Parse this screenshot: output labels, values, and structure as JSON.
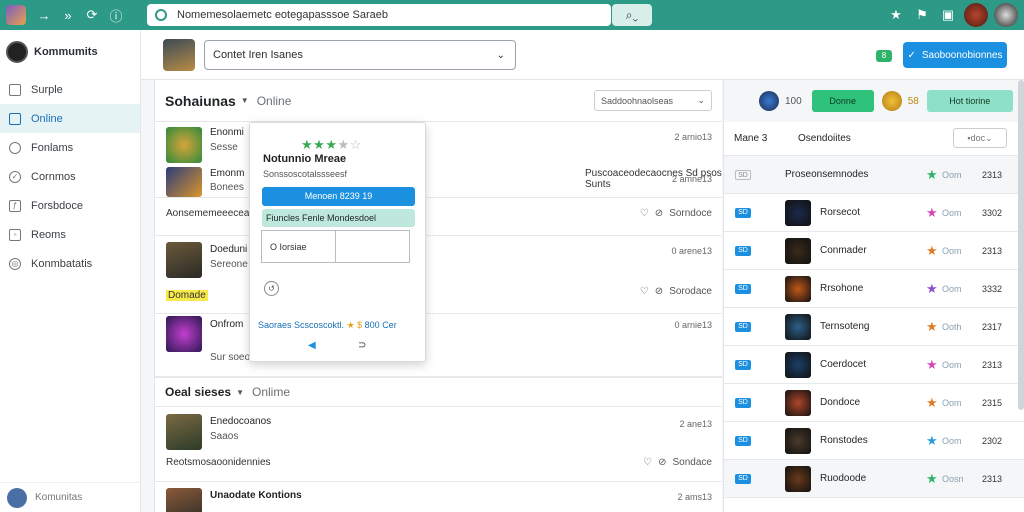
{
  "topbar": {
    "url": "Nomemesolaemetc eotegapasssoe Saraeb",
    "right_icons": [
      "star-icon",
      "flag-icon",
      "grid-icon",
      "avatar",
      "avatar"
    ]
  },
  "sidebar": {
    "brand": "Kommumits",
    "items": [
      {
        "label": "Surple",
        "icon": "square-icon"
      },
      {
        "label": "Online",
        "icon": "square-icon",
        "active": true
      },
      {
        "label": "Fonlams",
        "icon": "circle-icon"
      },
      {
        "label": "Cornmos",
        "icon": "check-icon"
      },
      {
        "label": "Forsbdoce",
        "icon": "tag-icon"
      },
      {
        "label": "Reoms",
        "icon": "chat-icon"
      },
      {
        "label": "Konmbatatis",
        "icon": "globe-icon"
      }
    ],
    "footer": "Komunitas"
  },
  "header": {
    "select_value": "Contet Iren Isanes",
    "badge": "8",
    "primary_button": "Saoboonobionnes"
  },
  "feed": {
    "section1": {
      "title": "Sohaiunas",
      "status": "Online",
      "sort": "Saddoohnaolseas"
    },
    "section2": {
      "title": "Oeal sieses",
      "status": "Onlime"
    },
    "items": [
      {
        "title": "Enonmi",
        "sub": "Sesse",
        "time": "2 arnio13"
      },
      {
        "title": "Emonm",
        "sub": "Bonees",
        "time": "2 amne13",
        "long": "Puscoaceodecaocnes Sd psos Sunts",
        "foot": "Aonsememeeeceass",
        "actions": "Sorndoce"
      },
      {
        "title": "Doeduni",
        "sub": "Sereone",
        "time": "0 arene13",
        "highlight": "Domade",
        "actions": "Sorodace"
      },
      {
        "title": "Onfrom",
        "sub": "Sur soeo",
        "time": "0 arnie13"
      },
      {
        "title": "Enedocoanos",
        "sub": "Saaos",
        "time": "2 ane13",
        "foot": "Reotsmosaoonidennies",
        "actions": "Sondace"
      },
      {
        "title": "Unaodate Kontions",
        "time": "2 ams13"
      }
    ]
  },
  "popover": {
    "rating": 3,
    "title": "Notunnio Mreae",
    "subtitle": "Sonssoscotalssseesf",
    "blue_label": "Menoen 8239 19",
    "green_label": "Fiuncles Fenle Mondesdoel",
    "input_left": "O Iorsiae",
    "link": "Saoraes Scscoscoktl.",
    "link_rating": "800",
    "link_tail": "Cer",
    "prev_label": "◀",
    "next_label": "⊃"
  },
  "right": {
    "coins1": "100",
    "button1": "Donne",
    "coins2": "58",
    "button2": "Hot tiorine",
    "col1": "Mane 3",
    "col2": "Osendoiites",
    "filter": "doc",
    "rows": [
      {
        "tag": "SD",
        "name": "Proseonsemnodes",
        "star": "#2fb36a",
        "stat": "Oom",
        "val": "2313"
      },
      {
        "tag": "SD",
        "name": "Rorsecot",
        "star": "#d548b2",
        "stat": "Oom",
        "val": "3302"
      },
      {
        "tag": "SD",
        "name": "Conmader",
        "star": "#e07b27",
        "stat": "Oom",
        "val": "2313"
      },
      {
        "tag": "SD",
        "name": "Rrsohone",
        "star": "#8a4ecb",
        "stat": "Oom",
        "val": "3332"
      },
      {
        "tag": "SD",
        "name": "Ternsoteng",
        "star": "#e07b27",
        "stat": "Ooth",
        "val": "2317"
      },
      {
        "tag": "SD",
        "name": "Coerdocet",
        "star": "#d548b2",
        "stat": "Oom",
        "val": "2313"
      },
      {
        "tag": "SD",
        "name": "Dondoce",
        "star": "#e07b27",
        "stat": "Oom",
        "val": "2315"
      },
      {
        "tag": "SD",
        "name": "Ronstodes",
        "star": "#2a9ad8",
        "stat": "Oom",
        "val": "2302"
      },
      {
        "tag": "SD",
        "name": "Ruodoode",
        "star": "#2fb36a",
        "stat": "Oosn",
        "val": "2313"
      }
    ]
  },
  "colors": {
    "topbar": "#2c9a86",
    "primary": "#1b8fe0",
    "accent_green": "#3aa957"
  }
}
